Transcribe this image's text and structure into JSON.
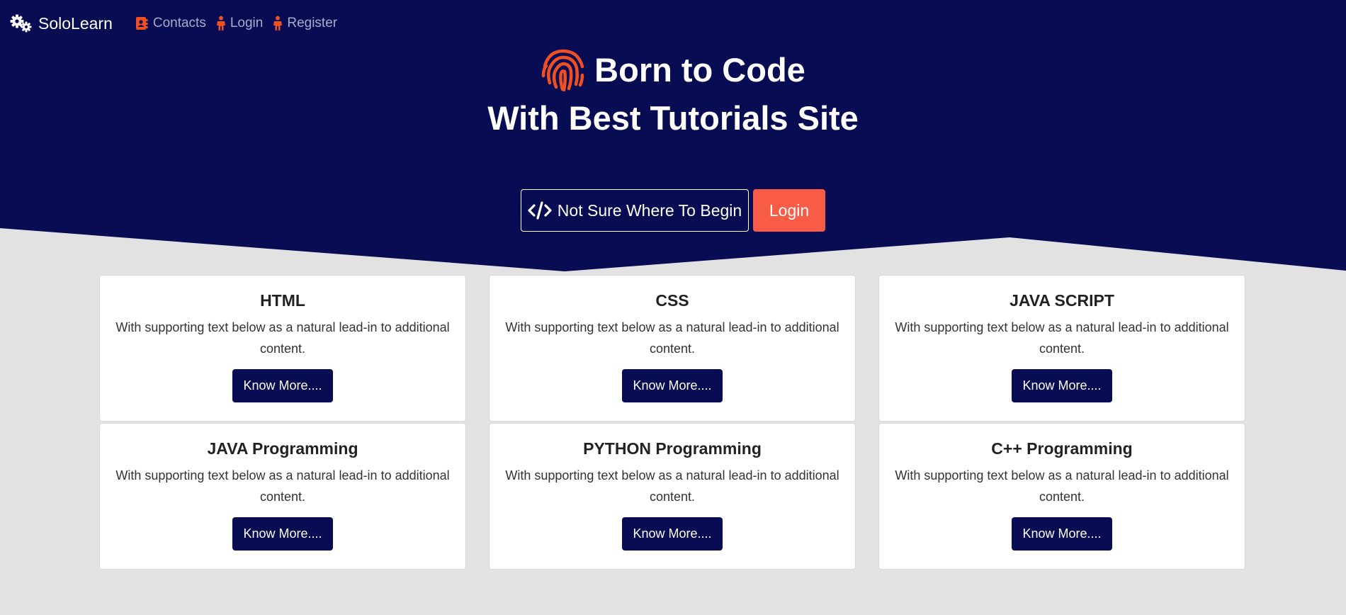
{
  "colors": {
    "hero_bg": "#070c53",
    "page_bg": "#e2e2e2",
    "accent_orange": "#f85c46",
    "icon_orange": "#f04e23",
    "button_navy": "#070c53"
  },
  "navbar": {
    "brand": "SoloLearn",
    "brand_icon": "gears-icon",
    "links": [
      {
        "label": "Contacts",
        "icon": "address-book-icon"
      },
      {
        "label": "Login",
        "icon": "person-icon"
      },
      {
        "label": "Register",
        "icon": "person-icon"
      }
    ]
  },
  "hero": {
    "title_icon": "fingerprint-icon",
    "title_line1": "Born to Code",
    "title_line2": "With Best Tutorials Site",
    "cta_outline_label": "Not Sure Where To Begin",
    "cta_outline_icon": "code-icon",
    "cta_login_label": "Login"
  },
  "cards": [
    {
      "title": "HTML",
      "text": "With supporting text below as a natural lead-in to additional content.",
      "button": "Know More...."
    },
    {
      "title": "CSS",
      "text": "With supporting text below as a natural lead-in to additional content.",
      "button": "Know More...."
    },
    {
      "title": "JAVA SCRIPT",
      "text": "With supporting text below as a natural lead-in to additional content.",
      "button": "Know More...."
    },
    {
      "title": "JAVA Programming",
      "text": "With supporting text below as a natural lead-in to additional content.",
      "button": "Know More...."
    },
    {
      "title": "PYTHON Programming",
      "text": "With supporting text below as a natural lead-in to additional content.",
      "button": "Know More...."
    },
    {
      "title": "C++ Programming",
      "text": "With supporting text below as a natural lead-in to additional content.",
      "button": "Know More...."
    }
  ]
}
